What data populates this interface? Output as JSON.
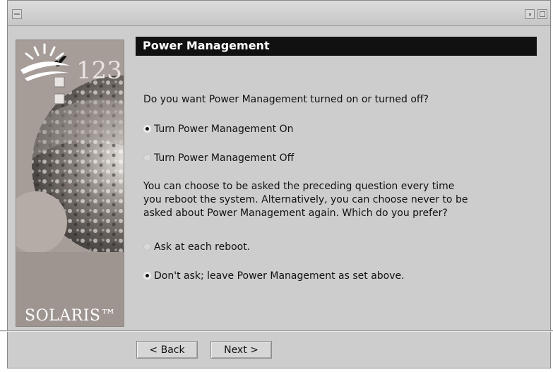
{
  "window": {
    "title": ""
  },
  "sidebar": {
    "steps_number": "123",
    "check_glyph": "✔",
    "brand": "SOLARIS™",
    "icons": [
      "sun-logo",
      "earth-image",
      "step-checklist"
    ]
  },
  "header": {
    "title": "Power Management"
  },
  "main": {
    "question1": "Do you want Power Management turned on or turned off?",
    "power_options": [
      {
        "label": "Turn Power Management On",
        "selected": true
      },
      {
        "label": "Turn Power Management Off",
        "selected": false
      }
    ],
    "explanation_lines": [
      "You can choose to be asked the preceding question every time",
      "you reboot the system.  Alternatively, you can choose never to be",
      "asked about Power Management again.  Which do you prefer?"
    ],
    "ask_options": [
      {
        "label": "Ask at each reboot.",
        "selected": false
      },
      {
        "label": "Don't ask; leave Power Management as set above.",
        "selected": true
      }
    ]
  },
  "footer": {
    "back_label": "< Back",
    "next_label": "Next >"
  },
  "colors": {
    "header_bar": "#111111",
    "window_bg": "#cdcdcd",
    "sidebar_bg": "#a69d99"
  }
}
